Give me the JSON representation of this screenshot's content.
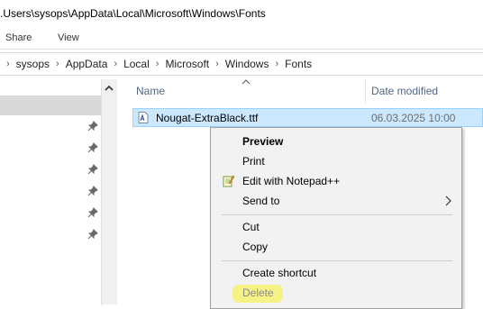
{
  "window": {
    "path_title": ".Users\\sysops\\AppData\\Local\\Microsoft\\Windows\\Fonts"
  },
  "ribbon": {
    "tabs": [
      "Share",
      "View"
    ]
  },
  "address_bar": {
    "crumbs": [
      "sysops",
      "AppData",
      "Local",
      "Microsoft",
      "Windows",
      "Fonts"
    ]
  },
  "columns": {
    "name": "Name",
    "date_modified": "Date modified"
  },
  "file": {
    "name": "Nougat-ExtraBlack.ttf",
    "date_modified": "06.03.2025 10:00",
    "icon": "font-file-icon"
  },
  "context_menu": {
    "items": [
      {
        "label": "Preview"
      },
      {
        "label": "Print"
      },
      {
        "label": "Edit with Notepad++",
        "icon": "notepad-plus-plus-icon"
      },
      {
        "label": "Send to"
      },
      {
        "label": "Cut"
      },
      {
        "label": "Copy"
      },
      {
        "label": "Create shortcut"
      },
      {
        "label": "Delete"
      }
    ]
  },
  "colors": {
    "selection": "#cce8ff",
    "highlight": "#f6f27a",
    "menu_bg": "#f2f2f2"
  }
}
